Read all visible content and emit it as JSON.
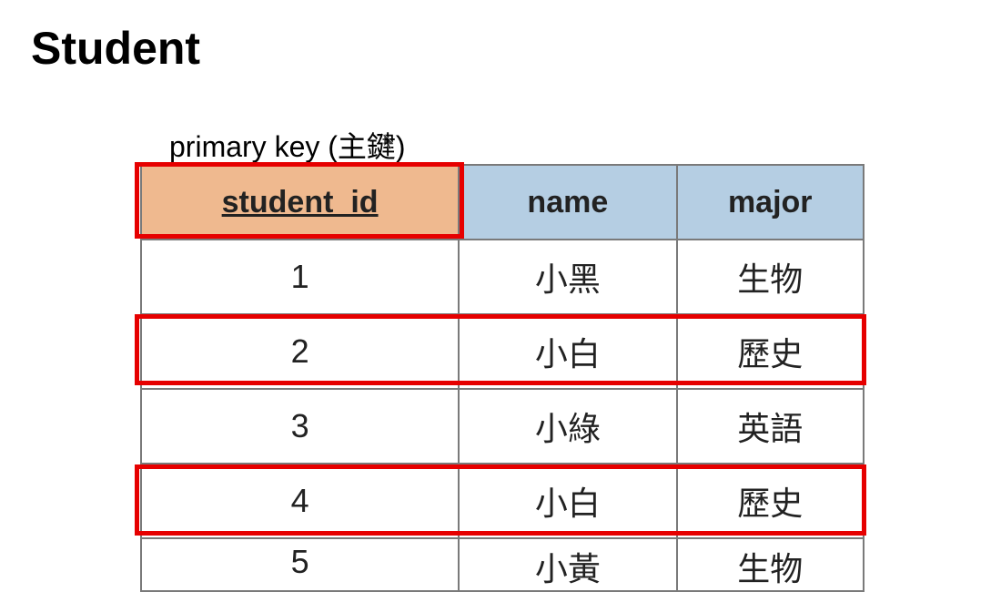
{
  "title": "Student",
  "primary_key_label": "primary key (主鍵)",
  "columns": {
    "id": "student_id",
    "name": "name",
    "major": "major"
  },
  "rows": [
    {
      "id": "1",
      "name": "小黑",
      "major": "生物"
    },
    {
      "id": "2",
      "name": "小白",
      "major": "歷史"
    },
    {
      "id": "3",
      "name": "小綠",
      "major": "英語"
    },
    {
      "id": "4",
      "name": "小白",
      "major": "歷史"
    },
    {
      "id": "5",
      "name": "小黃",
      "major": "生物"
    }
  ],
  "highlights": {
    "primary_key_column": true,
    "highlighted_rows": [
      2,
      4
    ]
  },
  "colors": {
    "primary_key_header_bg": "#efb98f",
    "column_header_bg": "#b5cee3",
    "highlight_border": "#e60000"
  }
}
